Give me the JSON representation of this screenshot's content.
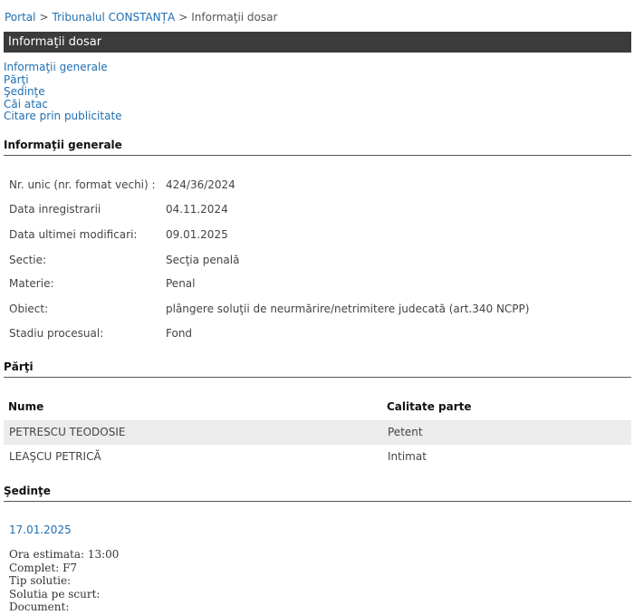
{
  "breadcrumb": {
    "portal": "Portal",
    "tribunal": "Tribunalul CONSTANȚA",
    "current": "Informaţii dosar",
    "separator": ">"
  },
  "page_title": "Informaţii dosar",
  "toc": [
    "Informaţii generale",
    "Părţi",
    "Şedinţe",
    "Căi atac",
    "Citare prin publicitate"
  ],
  "general": {
    "heading": "Informaţii generale",
    "rows": [
      {
        "label": "Nr. unic (nr. format vechi) :",
        "value": "424/36/2024"
      },
      {
        "label": "Data inregistrarii",
        "value": "04.11.2024"
      },
      {
        "label": "Data ultimei modificari:",
        "value": "09.01.2025"
      },
      {
        "label": "Sectie:",
        "value": "Secţia penală"
      },
      {
        "label": "Materie:",
        "value": "Penal"
      },
      {
        "label": "Obiect:",
        "value": "plângere soluţii de neurmărire/netrimitere judecată (art.340 NCPP)"
      },
      {
        "label": "Stadiu procesual:",
        "value": "Fond"
      }
    ]
  },
  "parti": {
    "heading": "Părţi",
    "col_name": "Nume",
    "col_role": "Calitate parte",
    "rows": [
      {
        "name": "PETRESCU TEODOSIE",
        "role": "Petent"
      },
      {
        "name": "LEAŞCU PETRICĂ",
        "role": "Intimat"
      }
    ]
  },
  "sedinte": {
    "heading": "Şedinţe",
    "date": "17.01.2025",
    "details": [
      "Ora estimata: 13:00",
      "Complet: F7",
      "Tip solutie:",
      "Solutia pe scurt:",
      "Document:"
    ]
  },
  "colors": {
    "link": "#1f6fb2",
    "title_bar": "#3b3b3b",
    "row_alt": "#ececec"
  }
}
